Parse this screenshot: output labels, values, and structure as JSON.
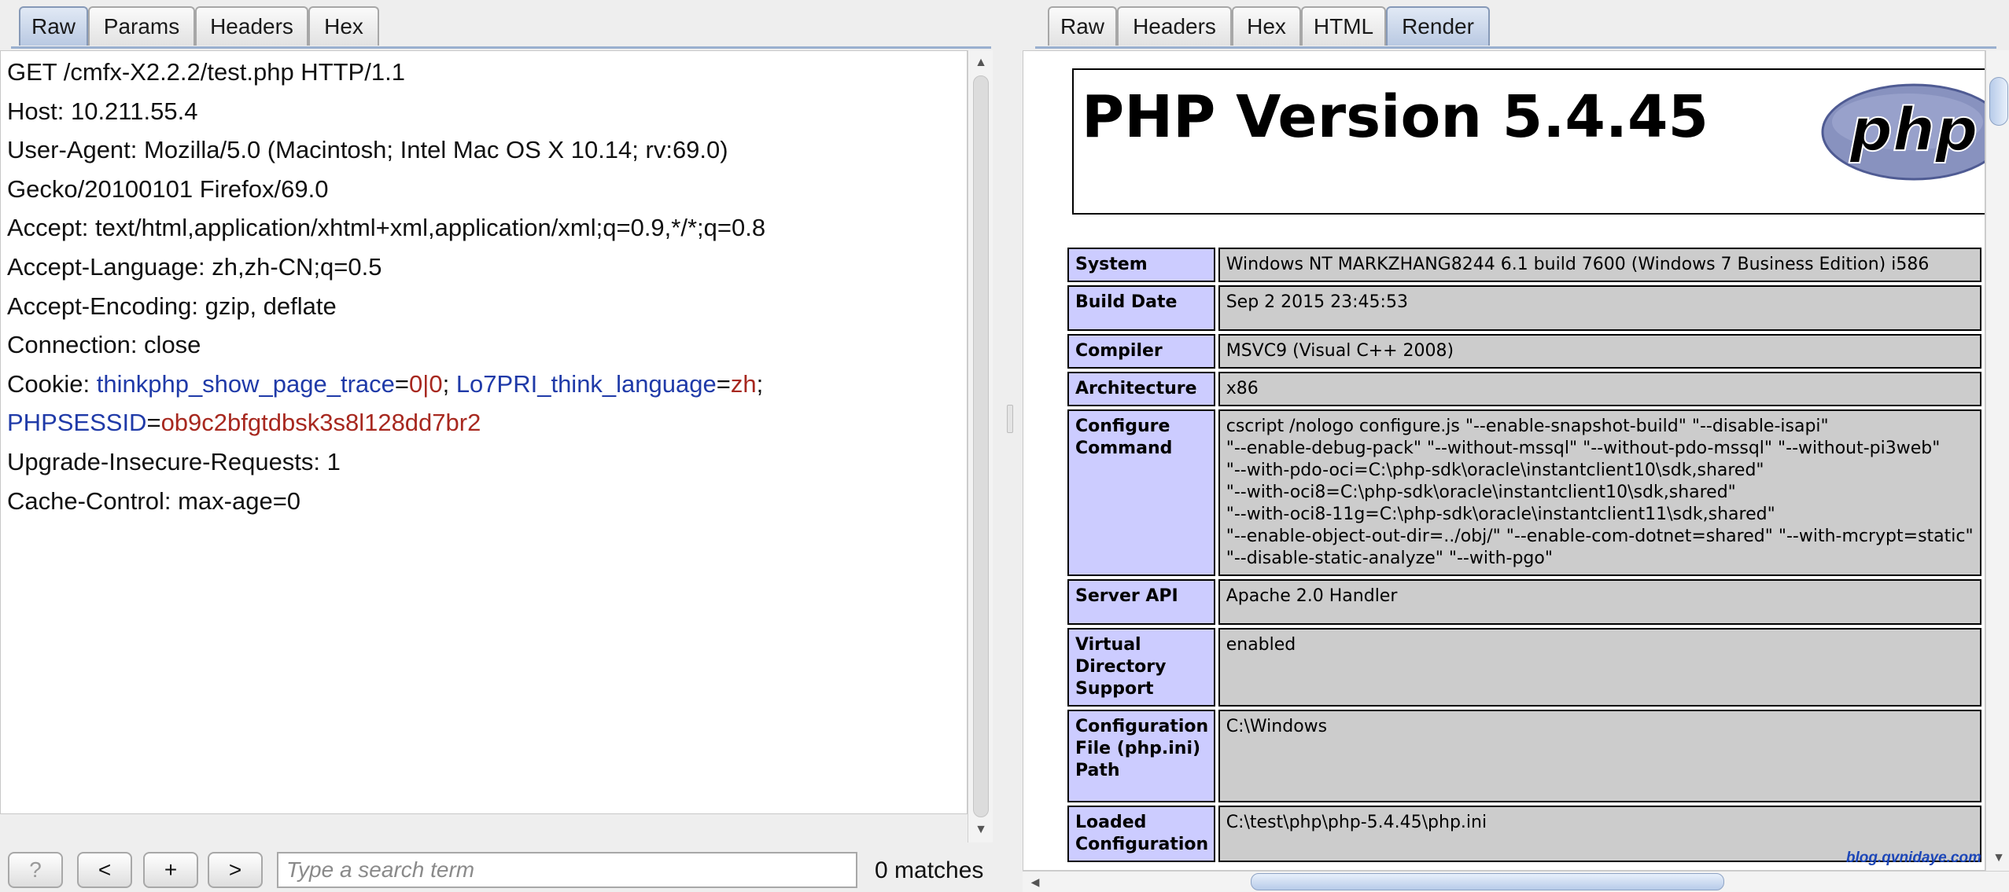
{
  "request": {
    "tabs": [
      "Raw",
      "Params",
      "Headers",
      "Hex"
    ],
    "active_tab": "Raw",
    "lines": [
      "GET /cmfx-X2.2.2/test.php HTTP/1.1",
      "Host: 10.211.55.4",
      "User-Agent: Mozilla/5.0 (Macintosh; Intel Mac OS X 10.14; rv:69.0)",
      "Gecko/20100101 Firefox/69.0",
      "Accept: text/html,application/xhtml+xml,application/xml;q=0.9,*/*;q=0.8",
      "Accept-Language: zh,zh-CN;q=0.5",
      "Accept-Encoding: gzip, deflate",
      "Connection: close"
    ],
    "cookie": {
      "prefix": "Cookie: ",
      "c1_name": "thinkphp_show_page_trace",
      "c1_value": "0|0",
      "c2_name": "Lo7PRI_think_language",
      "c2_value": "zh",
      "c3_name": "PHPSESSID",
      "c3_value": "ob9c2bfgtdbsk3s8l128dd7br2"
    },
    "lines_after": [
      "Upgrade-Insecure-Requests: 1",
      "Cache-Control: max-age=0"
    ]
  },
  "search": {
    "help_label": "?",
    "prev_label": "<",
    "add_label": "+",
    "next_label": ">",
    "placeholder": "Type a search term",
    "matches": "0 matches"
  },
  "response": {
    "tabs": [
      "Raw",
      "Headers",
      "Hex",
      "HTML",
      "Render"
    ],
    "active_tab": "Render",
    "php_title": "PHP Version 5.4.45",
    "logo_text": "php",
    "rows": [
      {
        "key": "System",
        "value": "Windows NT MARKZHANG8244 6.1 build 7600 (Windows 7 Business Edition) i586"
      },
      {
        "key": "Build Date",
        "value": "Sep 2 2015 23:45:53"
      },
      {
        "key": "Compiler",
        "value": "MSVC9 (Visual C++ 2008)"
      },
      {
        "key": "Architecture",
        "value": "x86"
      },
      {
        "key": "Configure\nCommand",
        "value": "cscript /nologo configure.js \"--enable-snapshot-build\" \"--disable-isapi\"\n\"--enable-debug-pack\" \"--without-mssql\" \"--without-pdo-mssql\" \"--without-pi3web\"\n\"--with-pdo-oci=C:\\php-sdk\\oracle\\instantclient10\\sdk,shared\"\n\"--with-oci8=C:\\php-sdk\\oracle\\instantclient10\\sdk,shared\"\n\"--with-oci8-11g=C:\\php-sdk\\oracle\\instantclient11\\sdk,shared\"\n\"--enable-object-out-dir=../obj/\" \"--enable-com-dotnet=shared\" \"--with-mcrypt=static\"\n\"--disable-static-analyze\" \"--with-pgo\""
      },
      {
        "key": "Server API",
        "value": "Apache 2.0 Handler"
      },
      {
        "key": "Virtual\nDirectory\nSupport",
        "value": "enabled"
      },
      {
        "key": "Configuration\nFile (php.ini)\nPath",
        "value": "C:\\Windows"
      },
      {
        "key": "Loaded\nConfiguration",
        "value": "C:\\test\\php\\php-5.4.45\\php.ini"
      }
    ]
  },
  "watermark": "blog.qvnidaye.com"
}
